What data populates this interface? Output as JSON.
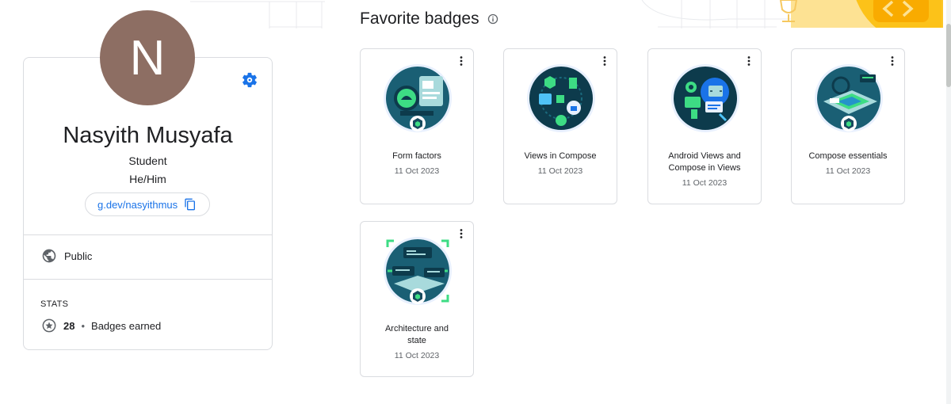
{
  "profile": {
    "avatar_letter": "N",
    "name": "Nasyith Musyafa",
    "role": "Student",
    "pronouns": "He/Him",
    "profile_link": "g.dev/nasyithmus",
    "visibility": "Public",
    "stats_heading": "STATS",
    "badges_count": "28",
    "stats_separator": "•",
    "badges_label": "Badges earned",
    "avatar_color": "#8d6e63"
  },
  "badges_section": {
    "title": "Favorite badges",
    "badges": [
      {
        "name": "Form factors",
        "date": "11 Oct 2023"
      },
      {
        "name": "Views in Compose",
        "date": "11 Oct 2023"
      },
      {
        "name": "Android Views and Compose in Views",
        "date": "11 Oct 2023"
      },
      {
        "name": "Compose essentials",
        "date": "11 Oct 2023"
      },
      {
        "name": "Architecture and state",
        "date": "11 Oct 2023"
      }
    ]
  },
  "colors": {
    "accent": "#1a73e8",
    "border": "#dadce0",
    "badge_dark": "#174a5e",
    "badge_green": "#3ddc84"
  }
}
